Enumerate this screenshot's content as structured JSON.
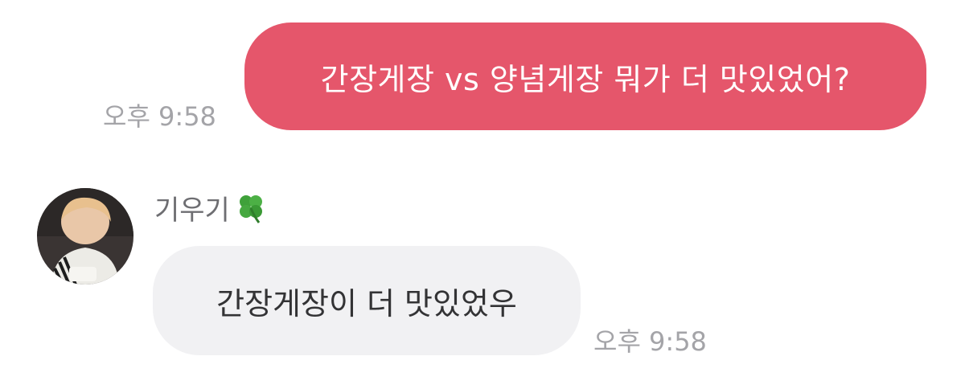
{
  "messages": {
    "sent": {
      "text": "간장게장 vs 양념게장 뭐가 더 맛있었어?",
      "time": "오후 9:58",
      "bubble_color": "#e5566b"
    },
    "received": {
      "sender": "기우기",
      "sender_icon": "four-leaf-clover-icon",
      "text": "간장게장이 더 맛있었우",
      "time": "오후 9:58",
      "bubble_color": "#f1f1f3"
    }
  }
}
